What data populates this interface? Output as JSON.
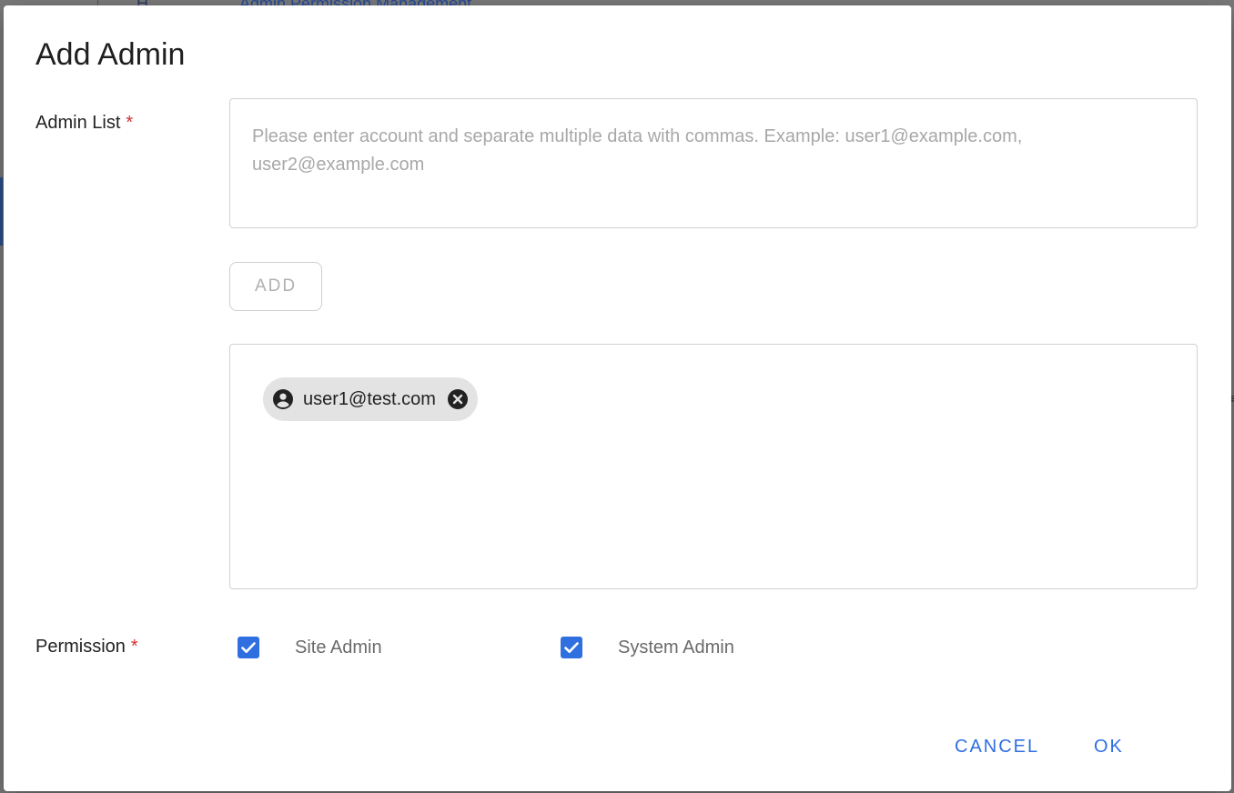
{
  "background": {
    "breadcrumb_first": "H",
    "breadcrumb_link": "Admin Permission Management"
  },
  "dialog": {
    "title": "Add Admin",
    "admin_list": {
      "label": "Admin List",
      "required_mark": "*",
      "input_value": "",
      "placeholder": "Please enter account and separate multiple data with commas. Example: user1@example.com, user2@example.com"
    },
    "add_button_label": "ADD",
    "chips": [
      {
        "label": "user1@test.com",
        "icon": "account-circle-icon",
        "remove_icon": "cancel-circle-icon"
      }
    ],
    "permission": {
      "label": "Permission",
      "required_mark": "*",
      "options": [
        {
          "label": "Site Admin",
          "checked": true
        },
        {
          "label": "System Admin",
          "checked": true
        }
      ]
    },
    "actions": {
      "cancel_label": "CANCEL",
      "ok_label": "OK"
    }
  },
  "colors": {
    "accent": "#2f6fe0",
    "required": "#d32f2f",
    "chip_bg": "#e3e3e3",
    "text_primary": "#222222",
    "text_muted": "#6a6a6a"
  }
}
